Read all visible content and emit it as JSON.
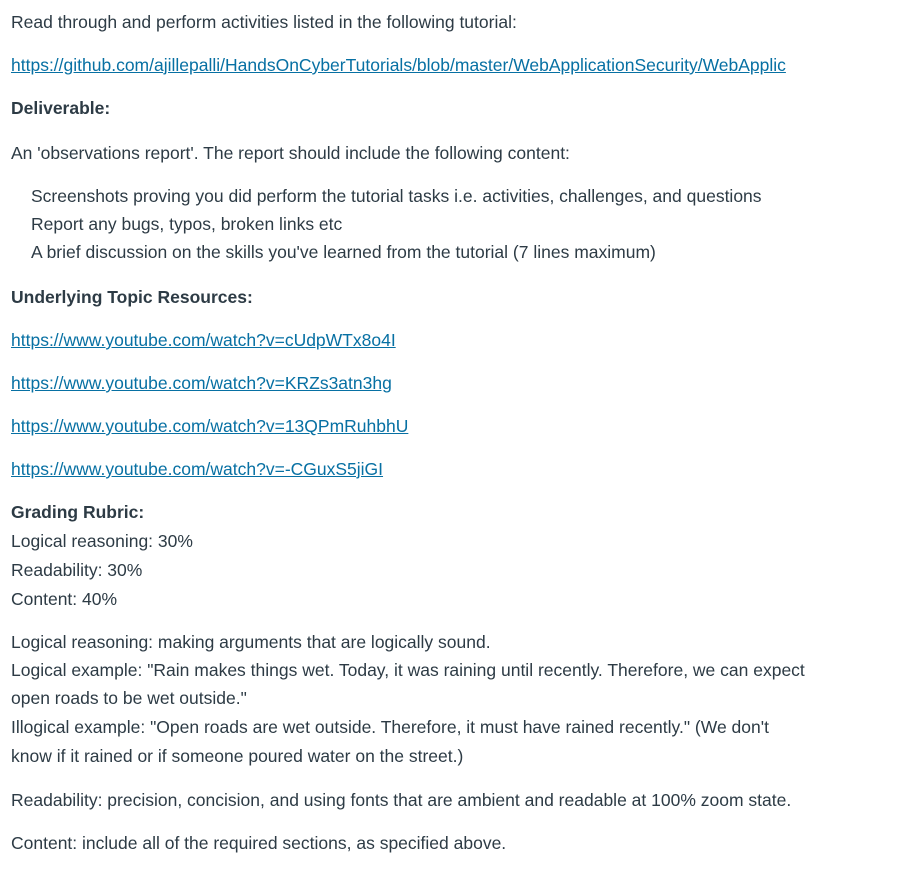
{
  "intro": "Read through and perform activities listed in the following tutorial:",
  "tutorial_link": "https://github.com/ajillepalli/HandsOnCyberTutorials/blob/master/WebApplicationSecurity/WebApplic",
  "deliverable_heading": "Deliverable:",
  "report_intro": "An 'observations report'. The report should include the following content:",
  "report_items": [
    "Screenshots proving you did perform the tutorial tasks i.e. activities, challenges, and questions",
    "Report any bugs, typos, broken links etc",
    "A brief discussion on the skills you've learned from the tutorial (7 lines maximum)"
  ],
  "resources_heading": "Underlying Topic Resources:",
  "resource_links": [
    "https://www.youtube.com/watch?v=cUdpWTx8o4I",
    "https://www.youtube.com/watch?v=KRZs3atn3hg",
    "https://www.youtube.com/watch?v=13QPmRuhbhU",
    "https://www.youtube.com/watch?v=-CGuxS5jiGI"
  ],
  "rubric_heading": "Grading Rubric:",
  "rubric_items": [
    "Logical reasoning: 30%",
    "Readability: 30%",
    "Content: 40%"
  ],
  "logic_lines": [
    "Logical reasoning: making arguments that are logically sound.",
    "Logical example: \"Rain makes things wet. Today, it was raining until recently. Therefore, we can expect",
    "open roads to be wet outside.\"",
    "Illogical example: \"Open roads are wet outside. Therefore, it must have rained recently.\" (We don't",
    "know if it rained or if someone poured water on the street.)"
  ],
  "readability_text": "Readability: precision, concision, and using fonts that are ambient and readable at 100% zoom state.",
  "content_text": "Content: include all of the required sections, as specified above."
}
